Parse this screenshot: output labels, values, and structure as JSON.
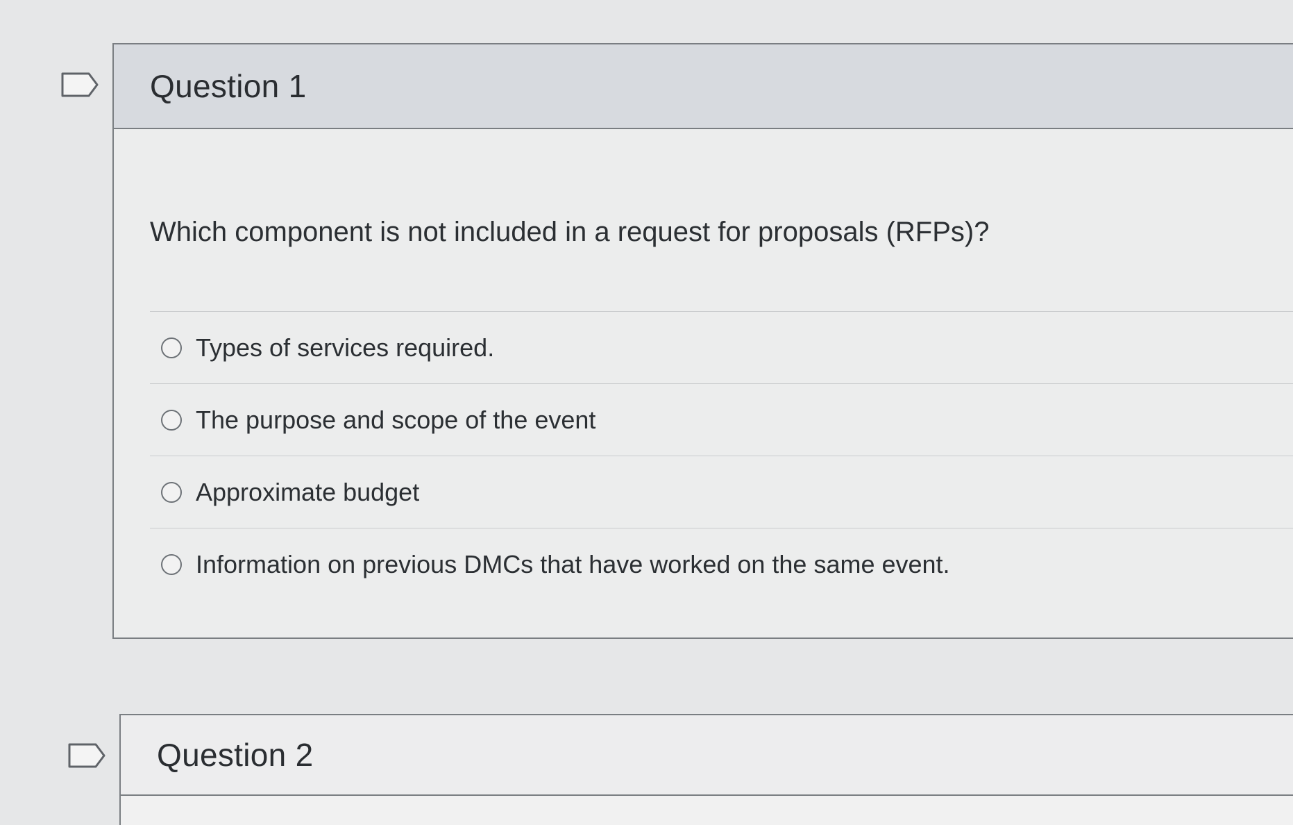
{
  "questions": [
    {
      "title": "Question 1",
      "prompt": "Which component is not included in a request for proposals (RFPs)?",
      "options": [
        "Types of services required.",
        "The purpose and scope of the event",
        "Approximate budget",
        "Information on previous DMCs that have worked on the same event."
      ]
    },
    {
      "title": "Question 2"
    }
  ],
  "icons": {
    "flag": "flag-question-icon",
    "radio": "radio-unselected-icon"
  },
  "colors": {
    "header_background": "#d7dadf",
    "card_background": "#eceded",
    "page_background": "#e6e7e8",
    "border": "#7a7e82"
  }
}
